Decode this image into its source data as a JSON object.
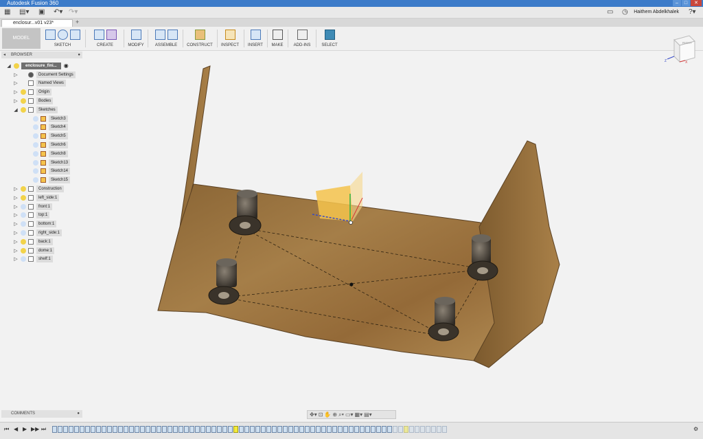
{
  "window": {
    "title": "Autodesk Fusion 360"
  },
  "header": {
    "user_name": "Haithem Abdelkhalek"
  },
  "document_tab": {
    "label": "enclosur...v01 v23*"
  },
  "toolbar": {
    "workspace": "MODEL",
    "groups": [
      "SKETCH",
      "CREATE",
      "MODIFY",
      "ASSEMBLE",
      "CONSTRUCT",
      "INSPECT",
      "INSERT",
      "MAKE",
      "ADD-INS",
      "SELECT"
    ]
  },
  "browser": {
    "title": "BROWSER",
    "root": "enclosure_fini...",
    "items": [
      {
        "label": "Document Settings"
      },
      {
        "label": "Named Views"
      },
      {
        "label": "Origin"
      },
      {
        "label": "Bodies"
      },
      {
        "label": "Sketches"
      },
      {
        "label": "Sketch3"
      },
      {
        "label": "Sketch4"
      },
      {
        "label": "Sketch5"
      },
      {
        "label": "Sketch6"
      },
      {
        "label": "Sketch8"
      },
      {
        "label": "Sketch13"
      },
      {
        "label": "Sketch14"
      },
      {
        "label": "Sketch15"
      },
      {
        "label": "Construction"
      },
      {
        "label": "left_side:1"
      },
      {
        "label": "front:1"
      },
      {
        "label": "top:1"
      },
      {
        "label": "bottom:1"
      },
      {
        "label": "right_side:1"
      },
      {
        "label": "back:1"
      },
      {
        "label": "dome:1"
      },
      {
        "label": "shelf:1"
      }
    ]
  },
  "viewcube": {
    "face": "RIGHT",
    "axis_x": "X",
    "axis_z": "Z"
  },
  "comments": {
    "label": "COMMENTS"
  },
  "colors": {
    "titlebar": "#3c7bc9",
    "wood": "#9b7440",
    "accent": "#4a78b8"
  }
}
